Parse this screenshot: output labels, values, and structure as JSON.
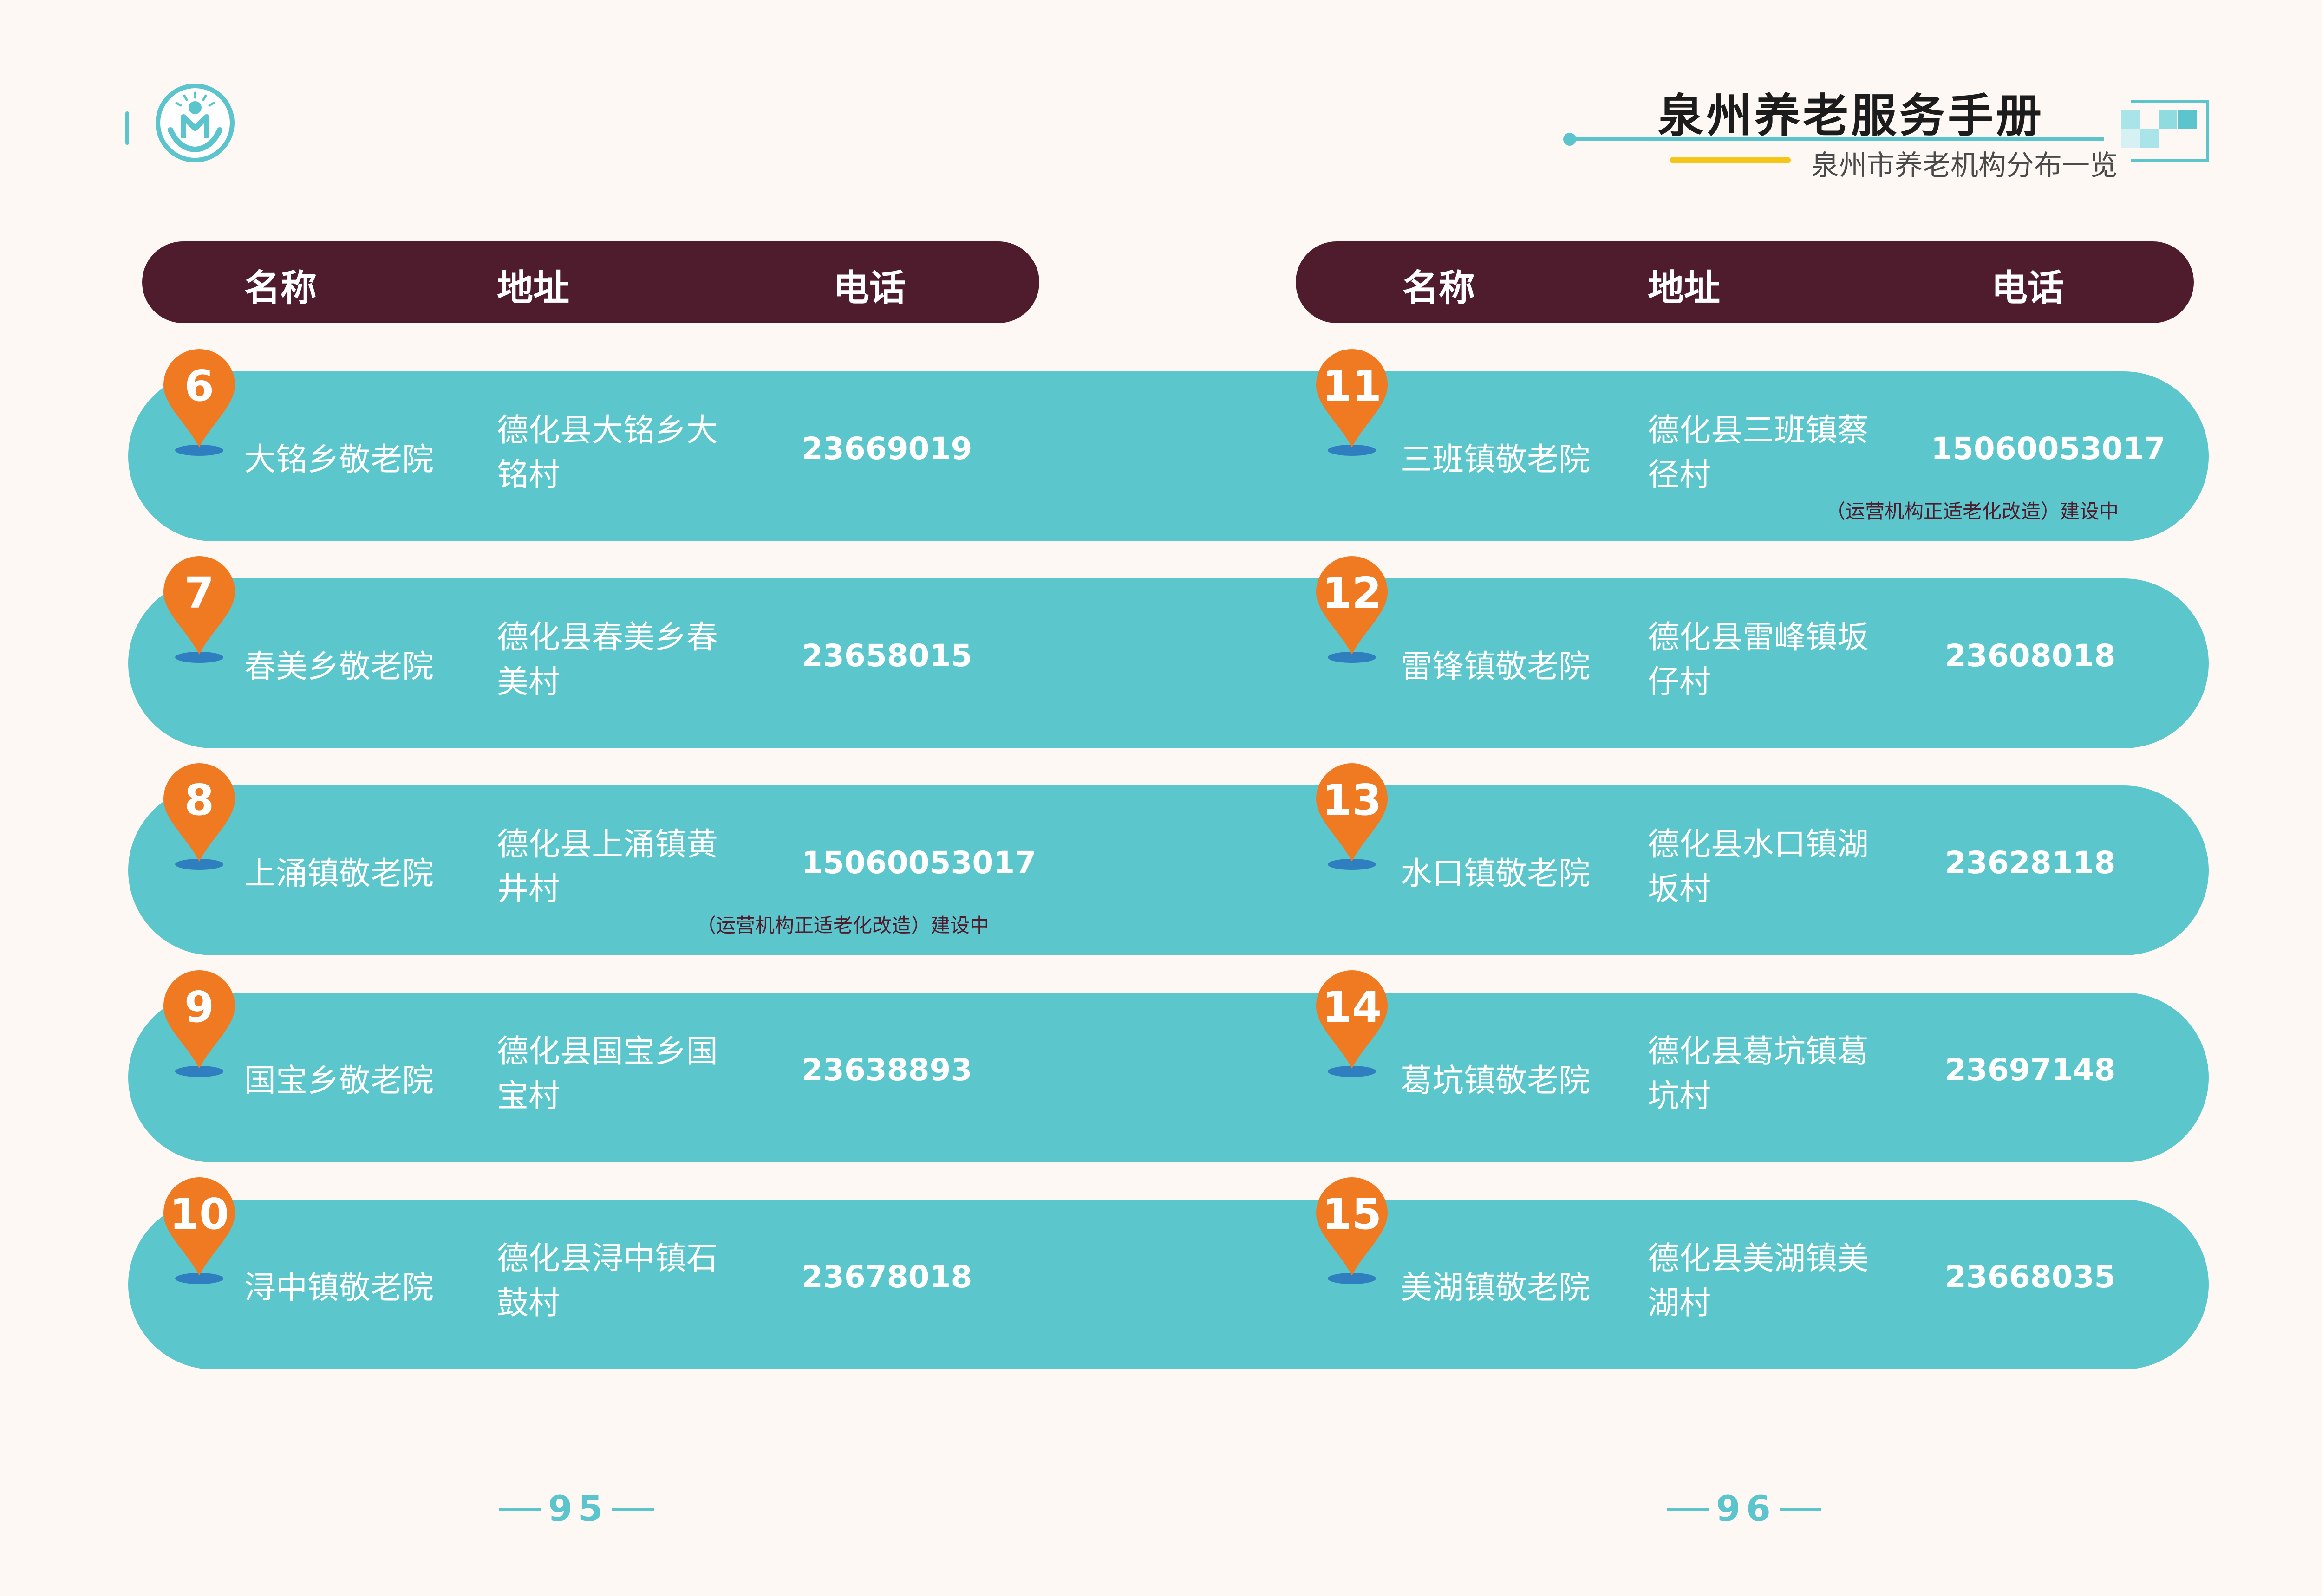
{
  "header": {
    "title": "泉州养老服务手册",
    "subtitle": "泉州市养老机构分布一览"
  },
  "table_header": {
    "name": "名称",
    "address": "地址",
    "phone": "电话"
  },
  "left_rows": [
    {
      "num": "6",
      "name": "大铭乡敬老院",
      "addr1": "德化县大铭乡大",
      "addr2": "铭村",
      "phone": "23669019",
      "note": ""
    },
    {
      "num": "7",
      "name": "春美乡敬老院",
      "addr1": "德化县春美乡春",
      "addr2": "美村",
      "phone": "23658015",
      "note": ""
    },
    {
      "num": "8",
      "name": "上涌镇敬老院",
      "addr1": "德化县上涌镇黄",
      "addr2": "井村",
      "phone": "15060053017",
      "note": "（运营机构正适老化改造）建设中"
    },
    {
      "num": "9",
      "name": "国宝乡敬老院",
      "addr1": "德化县国宝乡国",
      "addr2": "宝村",
      "phone": "23638893",
      "note": ""
    },
    {
      "num": "10",
      "name": "浔中镇敬老院",
      "addr1": "德化县浔中镇石",
      "addr2": "鼓村",
      "phone": "23678018",
      "note": ""
    }
  ],
  "right_rows": [
    {
      "num": "11",
      "name": "三班镇敬老院",
      "addr1": "德化县三班镇蔡",
      "addr2": "径村",
      "phone": "15060053017",
      "note": "（运营机构正适老化改造）建设中"
    },
    {
      "num": "12",
      "name": "雷锋镇敬老院",
      "addr1": "德化县雷峰镇坂",
      "addr2": "仔村",
      "phone": "23608018",
      "note": ""
    },
    {
      "num": "13",
      "name": "水口镇敬老院",
      "addr1": "德化县水口镇湖",
      "addr2": "坂村",
      "phone": "23628118",
      "note": ""
    },
    {
      "num": "14",
      "name": "葛坑镇敬老院",
      "addr1": "德化县葛坑镇葛",
      "addr2": "坑村",
      "phone": "23697148",
      "note": ""
    },
    {
      "num": "15",
      "name": "美湖镇敬老院",
      "addr1": "德化县美湖镇美",
      "addr2": "湖村",
      "phone": "23668035",
      "note": ""
    }
  ],
  "pages": {
    "left": "95",
    "right": "96"
  },
  "colors": {
    "row": "#5bc6cc",
    "header_bar": "#4f1c2e",
    "pin": "#f07a22",
    "background": "#fdf8f3"
  }
}
